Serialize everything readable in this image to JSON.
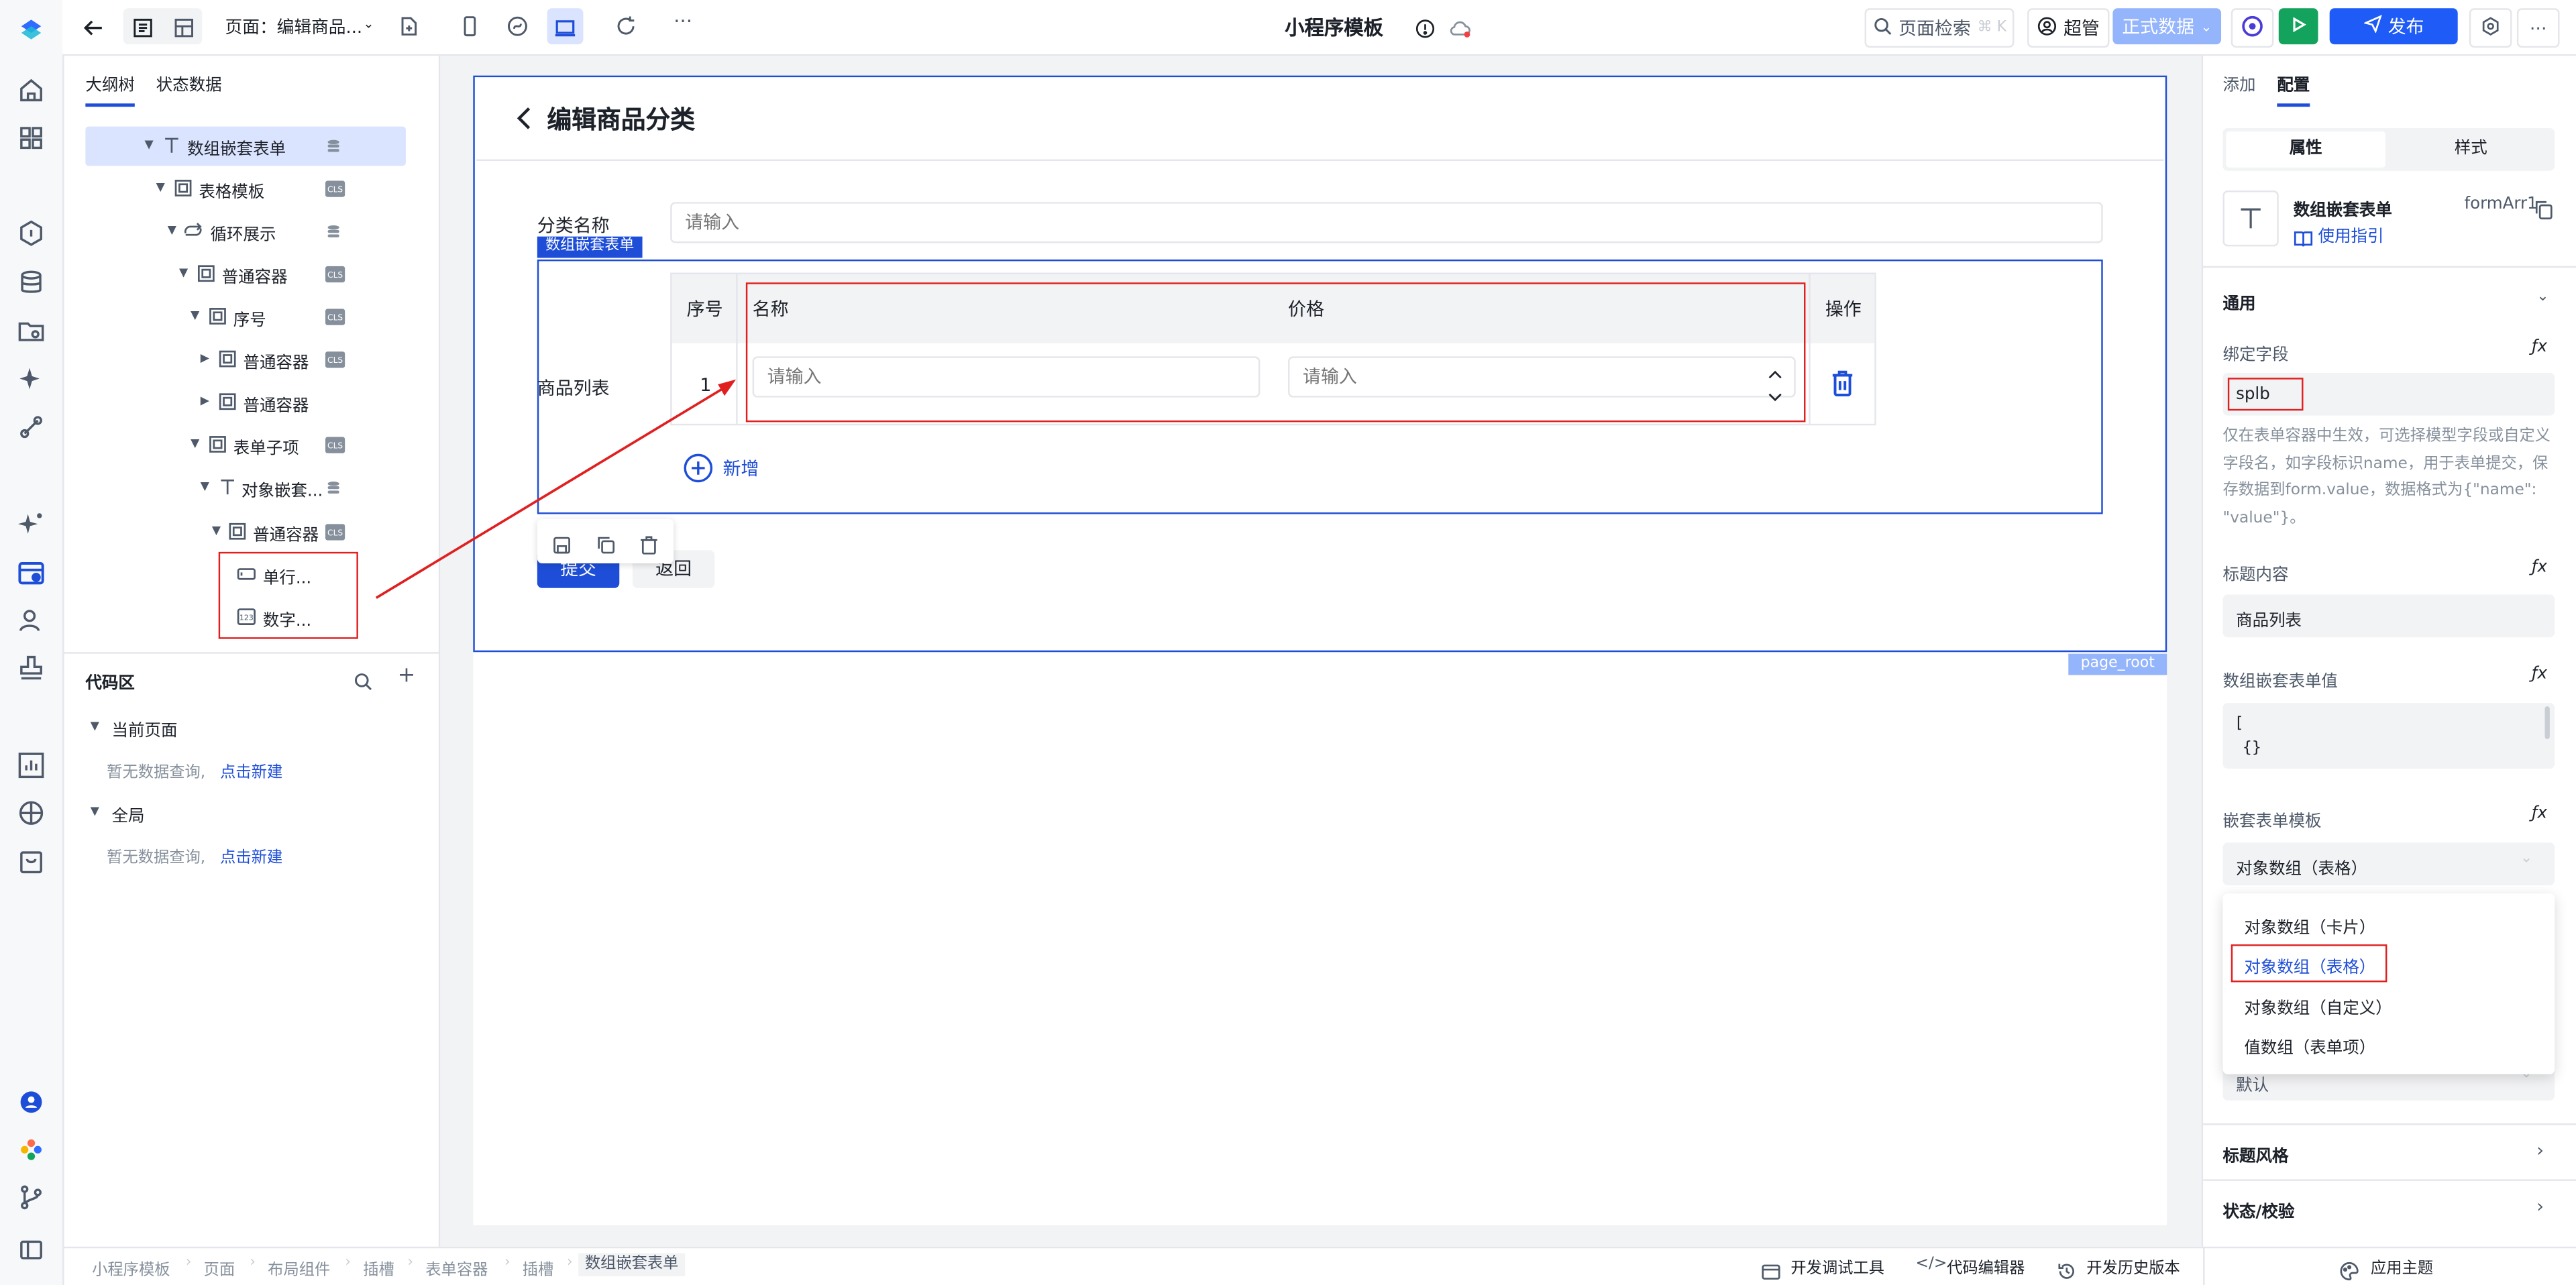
{
  "topbar": {
    "page_label": "页面：编辑商品...",
    "app_title": "小程序模板",
    "search_label": "页面检索",
    "search_shortcut": "⌘ K",
    "user_label": "超管",
    "env_label": "正式数据",
    "publish_label": "发布"
  },
  "left_panel": {
    "tabs": [
      "大纲树",
      "状态数据"
    ],
    "tree": [
      {
        "label": "数组嵌套表单"
      },
      {
        "label": "表格模板"
      },
      {
        "label": "循环展示"
      },
      {
        "label": "普通容器"
      },
      {
        "label": "序号"
      },
      {
        "label": "普通容器"
      },
      {
        "label": "普通容器"
      },
      {
        "label": "表单子项"
      },
      {
        "label": "对象嵌套..."
      },
      {
        "label": "普通容器"
      },
      {
        "label": "单行..."
      },
      {
        "label": "数字..."
      }
    ],
    "code_area": {
      "title": "代码区",
      "current_page": "当前页面",
      "empty_text": "暂无数据查询,",
      "new_link": "点击新建",
      "global": "全局"
    }
  },
  "canvas": {
    "page_title": "编辑商品分类",
    "category_label": "分类名称",
    "category_placeholder": "请输入",
    "nested_tag": "数组嵌套表单",
    "list_label": "商品列表",
    "table_headers": {
      "index": "序号",
      "name": "名称",
      "price": "价格",
      "action": "操作"
    },
    "row_index": "1",
    "name_placeholder": "请输入",
    "price_placeholder": "请输入",
    "add_label": "新增",
    "submit_label": "提交",
    "back_label": "返回",
    "page_root_tag": "page_root"
  },
  "right_panel": {
    "tabs": [
      "添加",
      "配置"
    ],
    "seg": [
      "属性",
      "样式"
    ],
    "component_name": "数组嵌套表单",
    "component_id": "formArr1",
    "guide_link": "使用指引",
    "section_general": "通用",
    "bind_field_label": "绑定字段",
    "bind_field_value": "splb",
    "help_text": "仅在表单容器中生效，可选择模型字段或自定义字段名，如字段标识name，用于表单提交，保存数据到form.value，数据格式为{\"name\": \"value\"}。",
    "title_content_label": "标题内容",
    "title_content_value": "商品列表",
    "nested_value_label": "数组嵌套表单值",
    "nested_value_line1": "[",
    "nested_value_line2": "{}",
    "nested_value_line3": "]",
    "template_label": "嵌套表单模板",
    "template_value": "对象数组（表格）",
    "options": [
      "对象数组（卡片）",
      "对象数组（表格）",
      "对象数组（自定义）",
      "值数组（表单项）"
    ],
    "default_value": "默认",
    "title_style": "标题风格",
    "status_check": "状态/校验"
  },
  "footer": {
    "breadcrumb": [
      "小程序模板",
      "页面",
      "布局组件",
      "插槽",
      "表单容器",
      "插槽",
      "数组嵌套表单"
    ],
    "tools": [
      "开发调试工具",
      "代码编辑器",
      "开发历史版本"
    ],
    "theme": "应用主题"
  },
  "colors": {
    "accent": "#1e4ed8",
    "highlight_red": "#e02020",
    "publish": "#1e5bf7",
    "run": "#14a35c"
  }
}
